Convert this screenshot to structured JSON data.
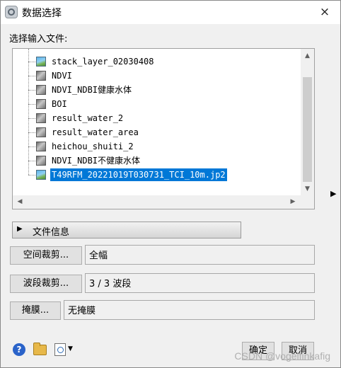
{
  "window": {
    "title": "数据选择",
    "app_icon": "app-icon",
    "close_icon": "×"
  },
  "input_files": {
    "label": "选择输入文件:",
    "items": [
      {
        "name": "stack_layer_02030408",
        "icon": "raster-color-icon",
        "selected": false
      },
      {
        "name": "NDVI",
        "icon": "raster-gray-icon",
        "selected": false
      },
      {
        "name": "NDVI_NDBI健康水体",
        "icon": "raster-gray-icon",
        "selected": false
      },
      {
        "name": "BOI",
        "icon": "raster-gray-icon",
        "selected": false
      },
      {
        "name": "result_water_2",
        "icon": "raster-gray-icon",
        "selected": false
      },
      {
        "name": "result_water_area",
        "icon": "raster-gray-icon",
        "selected": false
      },
      {
        "name": "heichou_shuiti_2",
        "icon": "raster-gray-icon",
        "selected": false
      },
      {
        "name": "NDVI_NDBI不健康水体",
        "icon": "raster-gray-icon",
        "selected": false
      },
      {
        "name": "T49RFM_20221019T030731_TCI_10m.jp2",
        "icon": "raster-color-icon",
        "selected": true
      }
    ],
    "scroll_up": "▲",
    "scroll_down": "▼",
    "scroll_left": "◀",
    "scroll_right": "▶"
  },
  "expand_arrow": "▶",
  "file_info": {
    "toggle": "▶",
    "label": "文件信息"
  },
  "spatial_subset": {
    "button": "空间裁剪...",
    "value": "全幅"
  },
  "spectral_subset": {
    "button": "波段裁剪...",
    "value": "3 / 3 波段"
  },
  "mask": {
    "button": "掩膜...",
    "value": "无掩膜"
  },
  "footer": {
    "help": "?",
    "dropdown": "▼",
    "ok": "确定",
    "cancel": "取消"
  },
  "watermark": "CSDN @vogelfinkafig"
}
